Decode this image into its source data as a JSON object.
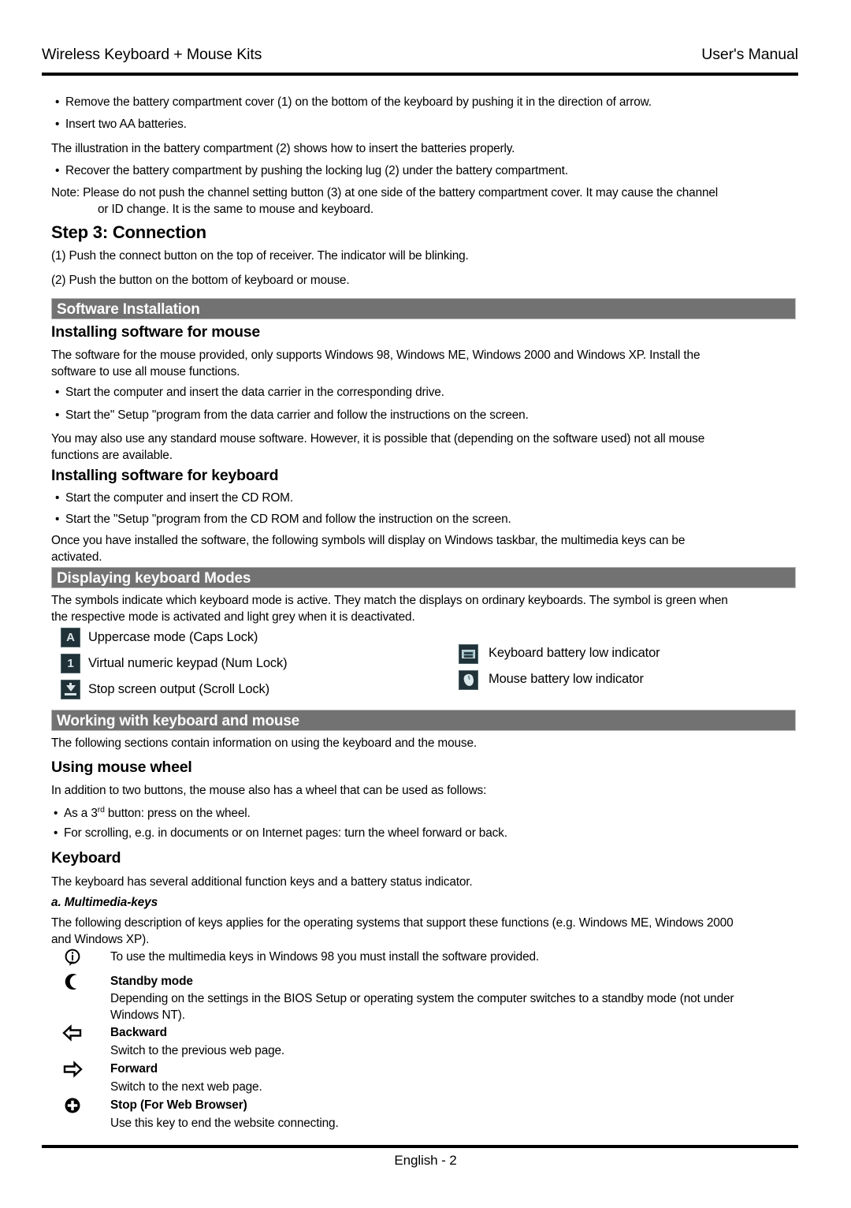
{
  "header": {
    "title": "Wireless Keyboard + Mouse Kits",
    "doc_type": "User's Manual"
  },
  "battery_section": {
    "bullets": [
      "Remove the battery compartment cover (1) on the bottom of the keyboard by pushing it in the direction of arrow.",
      "Insert two AA batteries."
    ],
    "illustration_note": "The illustration in the battery compartment (2) shows how to insert the batteries properly.",
    "recover_bullet": "Recover the battery compartment by pushing the locking lug (2) under the battery compartment.",
    "note_line1": "Note: Please do not push the channel setting button (3) at one side of the battery compartment cover. It may cause the channel",
    "note_line2": "or ID change.  It is the same to mouse and keyboard."
  },
  "step3": {
    "heading": "Step 3: Connection",
    "item1": "(1) Push the connect button on the top of receiver. The indicator will be blinking.",
    "item2": "(2) Push the button on the bottom of keyboard or mouse."
  },
  "software_installation": {
    "bar_title": "Software Installation",
    "mouse_heading": "Installing software for mouse",
    "mouse_para_line1": "The software for the mouse provided, only supports Windows 98, Windows ME, Windows 2000 and Windows XP. Install the",
    "mouse_para_line2": "software to use all mouse functions.",
    "mouse_bullets": [
      "Start the computer and insert the data carrier in the corresponding drive.",
      "Start the\" Setup \"program from the data carrier and follow the instructions on the screen."
    ],
    "mouse_note_line1": "You may also use any standard mouse software. However, it is possible that (depending on the software used) not all mouse",
    "mouse_note_line2": "functions are available.",
    "keyboard_heading": "Installing software for keyboard",
    "keyboard_bullets": [
      "Start the computer and insert the CD ROM.",
      "Start the \"Setup \"program from the CD ROM and follow the instruction on the screen."
    ],
    "keyboard_note_line1": "Once you have installed the software, the following symbols will display on Windows taskbar, the multimedia keys can be",
    "keyboard_note_line2": "activated."
  },
  "displaying_modes": {
    "bar_title": "Displaying keyboard Modes",
    "intro_line1": "The symbols indicate which keyboard mode is active. They match the displays on ordinary keyboards. The symbol is green when",
    "intro_line2": "the respective mode is activated and light grey when it is deactivated.",
    "left_items": [
      {
        "icon": "caps-lock-icon",
        "glyph": "A",
        "label": "Uppercase mode (Caps Lock)"
      },
      {
        "icon": "num-lock-icon",
        "glyph": "1",
        "label": "Virtual numeric keypad (Num Lock)"
      },
      {
        "icon": "scroll-lock-icon",
        "glyph": "",
        "label": "Stop screen output (Scroll Lock)"
      }
    ],
    "right_items": [
      {
        "icon": "keyboard-battery-icon",
        "label": "Keyboard battery low indicator"
      },
      {
        "icon": "mouse-battery-icon",
        "label": "Mouse battery low indicator"
      }
    ]
  },
  "working_section": {
    "bar_title": "Working with keyboard and mouse",
    "intro": "The following sections contain information on using the keyboard and the mouse.",
    "wheel_heading": "Using mouse wheel",
    "wheel_intro": "In addition to two buttons, the mouse also has a wheel that can be used as follows:",
    "wheel_bullet1_pre": "As a 3",
    "wheel_bullet1_sup": "rd",
    "wheel_bullet1_post": " button: press on the wheel.",
    "wheel_bullet2": "For scrolling, e.g. in documents or on Internet pages: turn the wheel forward or back."
  },
  "keyboard_section": {
    "heading": "Keyboard",
    "intro": "The keyboard has several additional function keys and a battery status indicator.",
    "subheading": "a. Multimedia-keys",
    "para_line1": "The following description of keys applies for the operating systems that support these functions (e.g. Windows ME, Windows 2000",
    "para_line2": "and Windows XP).",
    "info_note": "To use the multimedia keys in Windows 98 you must install the software provided.",
    "keys": [
      {
        "icon": "moon-icon",
        "label": "Standby mode",
        "desc_line1": "Depending on the settings in the BIOS Setup or operating system the computer switches to a standby mode (not under",
        "desc_line2": "Windows NT)."
      },
      {
        "icon": "arrow-left-icon",
        "label": "Backward",
        "desc_line1": "Switch to the previous web page.",
        "desc_line2": ""
      },
      {
        "icon": "arrow-right-icon",
        "label": "Forward",
        "desc_line1": "Switch to the next web page.",
        "desc_line2": ""
      },
      {
        "icon": "stop-plus-icon",
        "label": "Stop (For Web Browser)",
        "desc_line1": "Use this key to end the website connecting.",
        "desc_line2": ""
      }
    ]
  },
  "footer": {
    "page_label": "English - 2"
  },
  "colors": {
    "section_bar": "#727272",
    "section_bar_text": "#ffffff",
    "icon_background": "#203138",
    "icon_glyph": "#d8e4e8",
    "text": "#000000"
  }
}
